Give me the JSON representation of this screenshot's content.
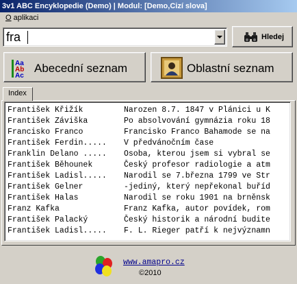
{
  "window": {
    "title": "3v1 ABC Encyklopedie  (Demo) | Modul: [Demo,Cizí slova]"
  },
  "menu": {
    "about_first": "O",
    "about_rest": " aplikaci"
  },
  "search": {
    "value": "fra",
    "button_label": "Hledej"
  },
  "buttons": {
    "abc_list": "Abecední seznam",
    "area_list": "Oblastní seznam"
  },
  "tabs": {
    "index": "Index"
  },
  "results": [
    {
      "term": "František Křižík",
      "desc": "Narozen 8.7. 1847 v Plánici u K"
    },
    {
      "term": "František Záviška",
      "desc": "Po absolvování gymnázia roku 18"
    },
    {
      "term": "Francisko Franco",
      "desc": "Francisko Franco Bahamode se na"
    },
    {
      "term": "František Ferdin.....",
      "desc": "V předvánočním čase"
    },
    {
      "term": "Franklin Delano .....",
      "desc": "Osoba, kterou jsem si vybral se"
    },
    {
      "term": "František Běhounek",
      "desc": "Český profesor radiologie a atm"
    },
    {
      "term": "František Ladisl.....",
      "desc": "Narodil se 7.března 1799 ve Str"
    },
    {
      "term": "František Gelner",
      "desc": "-jediný, který nepřekonal buříd"
    },
    {
      "term": "František Halas",
      "desc": "Narodil se roku 1901 na brněnsk"
    },
    {
      "term": "Franz Kafka",
      "desc": "Franz Kafka, autor povídek, rom"
    },
    {
      "term": "František Palacký",
      "desc": "Český historik a národní budite"
    },
    {
      "term": "František Ladisl.....",
      "desc": "F. L. Rieger patří k nejvýznamn"
    }
  ],
  "footer": {
    "url": "www.amapro.cz",
    "copyright": "©2010"
  },
  "colors": {
    "title_start": "#0a246a",
    "title_end": "#a6caf0",
    "face": "#d4d0c8",
    "link": "#00008b"
  },
  "icons": {
    "search": "binoculars-icon",
    "abc": "abc-icon",
    "area": "person-portrait-icon",
    "logo": "balloons-logo"
  }
}
